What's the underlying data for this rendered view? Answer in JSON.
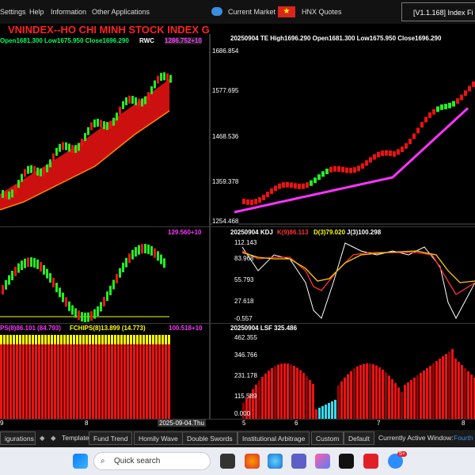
{
  "menu": {
    "items": [
      "Settings",
      "Help",
      "Information",
      "Other Applications"
    ],
    "current_market": "Current Market",
    "hnx_quotes": "HNX Quotes",
    "version": "[V1.1.168] Index Fi"
  },
  "main_chart": {
    "title": "VNINDEX--HO CHI MINH STOCK INDEX  GP",
    "ohlc": "Open1681.300 Low1675.950 Close1696.290",
    "tag": "RWC",
    "last": "1286.752+10"
  },
  "right_chart": {
    "header": "20250904 TE High1696.290 Open1681.300 Low1675.950 Close1696.290",
    "y_ticks": [
      "1686.854",
      "1577.695",
      "1468.536",
      "1359.378",
      "1254.468"
    ]
  },
  "mid_left": {
    "value": "129.560+10"
  },
  "kdj": {
    "date": "20250904 KDJ",
    "k": "K(9)86.113",
    "d": "D(3)79.020",
    "j": "J(3)100.298",
    "y_ticks": [
      "112.143",
      "83.968",
      "55.793",
      "27.618",
      "-0.557"
    ]
  },
  "fchips": {
    "label": "PS(8)86.101 (84.793)",
    "label2": "FCHIPS(8)13.899 (14.773)",
    "value": "100.518+10"
  },
  "lsf": {
    "header": "20250904 LSF 325.486",
    "y_ticks": [
      "462.355",
      "346.766",
      "231.178",
      "115.589",
      "0.000"
    ],
    "x_ticks": [
      "5",
      "6",
      "7",
      "8"
    ]
  },
  "left_x_ticks": [
    "9",
    "8"
  ],
  "date_label": "2025-09-04.Thu",
  "bottom": {
    "buttons": [
      "igurations",
      "Template",
      "Fund Trend",
      "Homily Wave",
      "Double Swords",
      "Institutional Arbitrage",
      "Custom",
      "Default"
    ],
    "active_window_label": "Currently Active Window:",
    "active_window": "Fourth"
  },
  "taskbar": {
    "search_placeholder": "Quick search",
    "badge": "5+"
  },
  "colors": {
    "up": "#22ee22",
    "down": "#ee1111",
    "magenta": "#ff33ff",
    "yellow": "#ffff00"
  },
  "chart_data": [
    {
      "type": "line",
      "title": "VNINDEX--HO CHI MINH STOCK INDEX",
      "note": "candlestick",
      "y_range": [
        1254.468,
        1686.854
      ]
    },
    {
      "type": "line",
      "title": "KDJ",
      "series": [
        {
          "name": "K",
          "last": 86.113
        },
        {
          "name": "D",
          "last": 79.02
        },
        {
          "name": "J",
          "last": 100.298
        }
      ],
      "y_range": [
        -0.557,
        112.143
      ]
    },
    {
      "type": "bar",
      "title": "LSF",
      "last": 325.486,
      "y_range": [
        0.0,
        462.355
      ]
    }
  ]
}
